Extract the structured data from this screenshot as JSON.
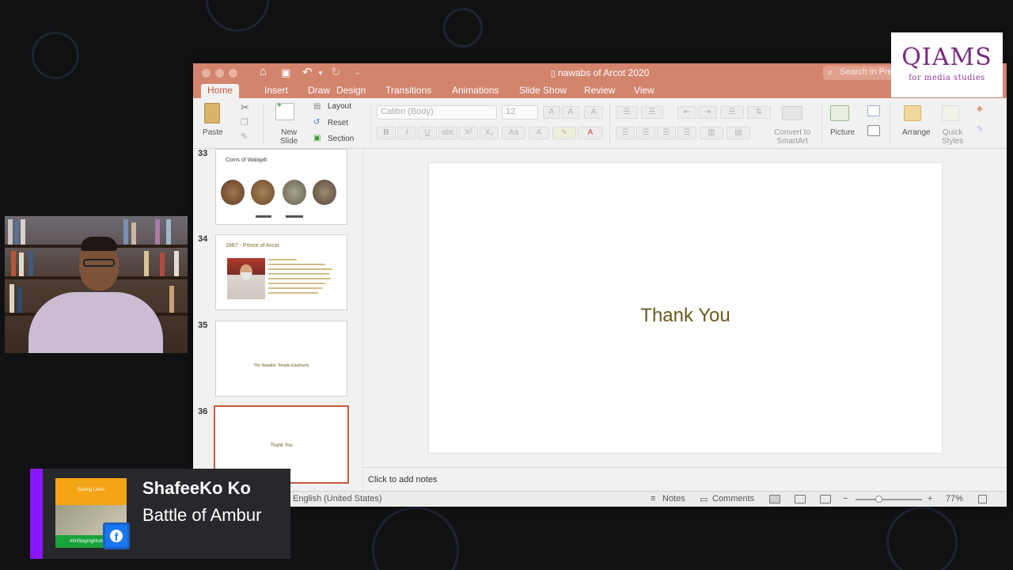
{
  "window": {
    "title": "nawabs of Arcot 2020",
    "search_placeholder": "Search in Presentation"
  },
  "ribbon": {
    "tabs": [
      {
        "label": "Home"
      },
      {
        "label": "Insert"
      },
      {
        "label": "Draw"
      },
      {
        "label": "Design"
      },
      {
        "label": "Transitions"
      },
      {
        "label": "Animations"
      },
      {
        "label": "Slide Show"
      },
      {
        "label": "Review"
      },
      {
        "label": "View"
      }
    ],
    "paste": "Paste",
    "new_slide_line1": "New",
    "new_slide_line2": "Slide",
    "layout": "Layout",
    "reset": "Reset",
    "section": "Section",
    "font_name": "Calibri (Body)",
    "font_size": "12",
    "convert_line1": "Convert to",
    "convert_line2": "SmartArt",
    "picture": "Picture",
    "arrange": "Arrange",
    "quick_styles_line1": "Quick",
    "quick_styles_line2": "Styles"
  },
  "slides": [
    {
      "number": "33",
      "title": "Coins of Walajah"
    },
    {
      "number": "34",
      "title": "1867 - Prince of Arcot"
    },
    {
      "number": "35",
      "title": "The Nawabs' Temple Elephants"
    },
    {
      "number": "36",
      "title": "Thank You"
    }
  ],
  "current_slide": {
    "text": "Thank You"
  },
  "notes_placeholder": "Click to add notes",
  "statusbar": {
    "language": "English (United States)",
    "notes": "Notes",
    "comments": "Comments",
    "zoom": "77%"
  },
  "zoom_level": 0.35,
  "logo": {
    "main": "QIAMS",
    "sub": "for media studies"
  },
  "lower_third": {
    "name": "ShafeeKo Ko",
    "subtitle": "Battle of Ambur",
    "avatar_top": "Saving Lives",
    "avatar_bottom": "#ImStayingHome"
  },
  "colors": {
    "ribbon_accent": "#d2846d",
    "selection": "#c75b3e",
    "slide_text": "#6b5a1c",
    "lower_third_bar": "#8a17ff",
    "logo": "#7a2a82"
  }
}
